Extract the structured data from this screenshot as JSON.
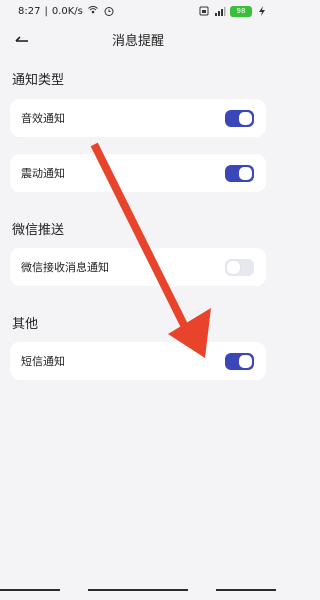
{
  "status_bar": {
    "time": "8:27",
    "network_speed": "0.0K/s",
    "battery": "98",
    "icons": [
      "wifi-hotspot-icon",
      "alarm-icon",
      "sim-icon",
      "signal-icon",
      "battery-icon",
      "charging-icon"
    ]
  },
  "header": {
    "title": "消息提醒",
    "back_icon": "back-arrow-icon"
  },
  "sections": [
    {
      "title": "通知类型",
      "items": [
        {
          "label": "音效通知",
          "enabled": true
        },
        {
          "label": "震动通知",
          "enabled": true
        }
      ]
    },
    {
      "title": "微信推送",
      "items": [
        {
          "label": "微信接收消息通知",
          "enabled": false
        }
      ]
    },
    {
      "title": "其他",
      "items": [
        {
          "label": "短信通知",
          "enabled": true
        }
      ]
    }
  ],
  "annotation": {
    "type": "arrow",
    "color": "#e8442c"
  },
  "colors": {
    "toggle_on": "#3b47b8",
    "toggle_off": "#e7e7ee",
    "background": "#f4f4f6",
    "card": "#ffffff"
  }
}
